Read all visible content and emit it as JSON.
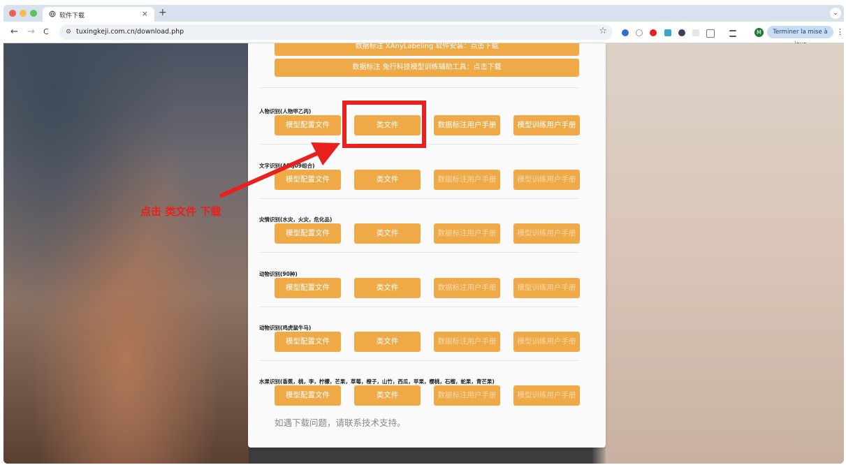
{
  "browser": {
    "tab_title": "软件下载",
    "tab_close": "×",
    "new_tab": "+",
    "tab_menu": "⌄",
    "url": "tuxingkeji.com.cn/download.php",
    "avatar_initial": "M",
    "finish_update_label": "Terminer la mise à jour",
    "nav_back": "←",
    "nav_forward": "→",
    "nav_reload": "C",
    "bookmark_star": "☆",
    "menu": "⋮"
  },
  "page": {
    "top_buttons": [
      "数据标注 XAnyLabeling 软件安装：点击下载",
      "数据标注 兔行科技模型训练辅助工具：点击下载"
    ],
    "sections": [
      {
        "title": "人物识别(人物甲乙丙)",
        "buttons": [
          "模型配置文件",
          "类文件",
          "数据标注用户手册",
          "模型训练用户手册"
        ]
      },
      {
        "title": "文字识别(ABIJ09组合)",
        "buttons": [
          "模型配置文件",
          "类文件",
          "数据标注用户手册",
          "模型训练用户手册"
        ]
      },
      {
        "title": "灾情识别(水灾，火灾，危化品)",
        "buttons": [
          "模型配置文件",
          "类文件",
          "数据标注用户手册",
          "模型训练用户手册"
        ]
      },
      {
        "title": "动物识别(90种)",
        "buttons": [
          "模型配置文件",
          "类文件",
          "数据标注用户手册",
          "模型训练用户手册"
        ]
      },
      {
        "title": "动物识别(鸡虎鼠牛马)",
        "buttons": [
          "模型配置文件",
          "类文件",
          "数据标注用户手册",
          "模型训练用户手册"
        ]
      },
      {
        "title": "水果识别(香蕉，桃，李，柠檬，芒果，草莓，橙子，山竹，西瓜，苹果，樱桃，石榴，蛇果，青芒果)",
        "buttons": [
          "模型配置文件",
          "类文件",
          "数据标注用户手册",
          "模型训练用户手册"
        ]
      }
    ],
    "footer_note": "如遇下载问题，请联系技术支持。"
  },
  "annotation": {
    "text": "点击 类文件 下载",
    "color": "#e8201e"
  },
  "colors": {
    "button": "#efaa47",
    "traffic_red": "#ec5f57",
    "traffic_yellow": "#f4bd4f",
    "traffic_green": "#5ec454"
  }
}
